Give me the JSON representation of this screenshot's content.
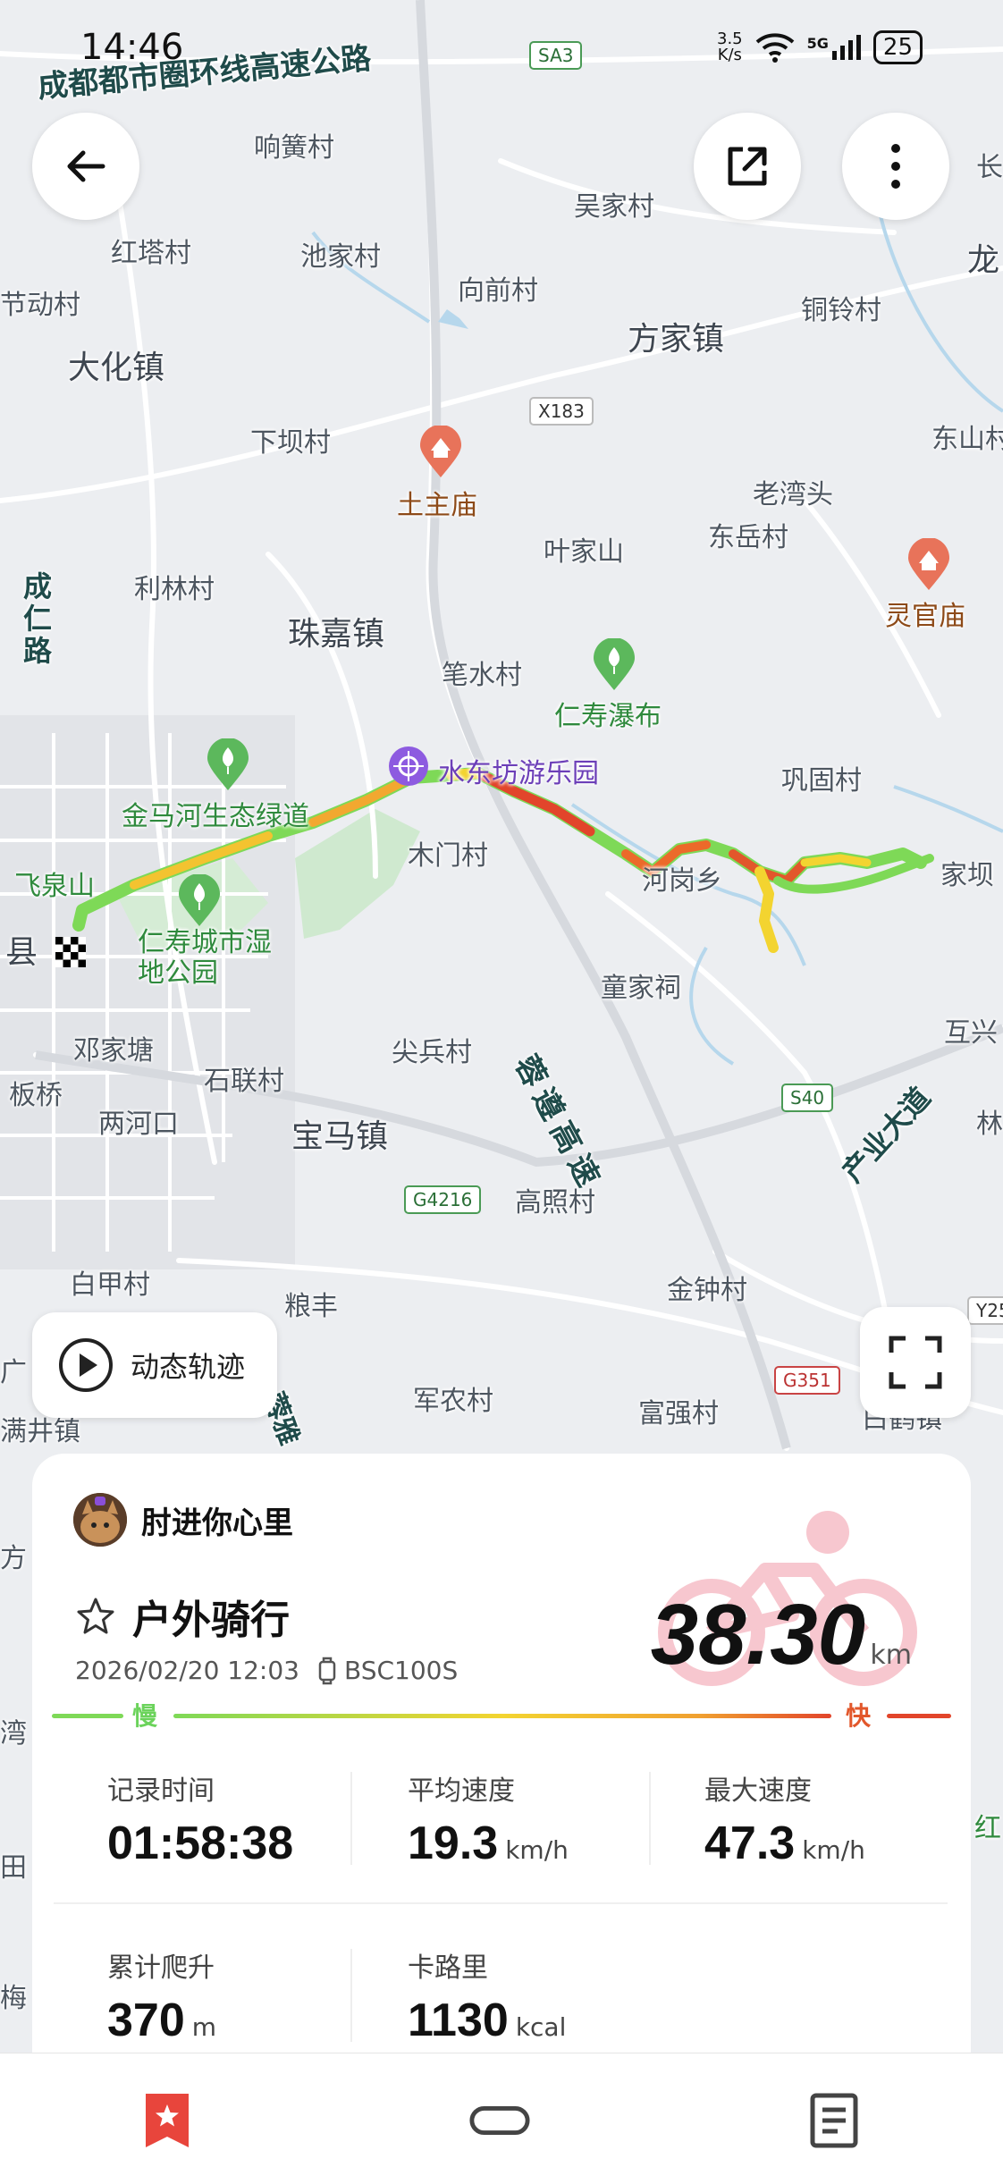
{
  "status_bar": {
    "time": "14:46",
    "net_speed_value": "3.5",
    "net_speed_unit": "K/s",
    "network_type": "5G",
    "battery": "25"
  },
  "map": {
    "roads": {
      "ring_expressway": "成都都市圈环线高速公路",
      "rong_zun": "蓉遵高速",
      "industry_ave": "产业大道",
      "left_road": "成仁路",
      "bottom_road": "蓉雅"
    },
    "shields": [
      "SA3",
      "X183",
      "S40",
      "G4216",
      "G351",
      "Y25"
    ],
    "towns": [
      "大化镇",
      "方家镇",
      "珠嘉镇",
      "宝马镇"
    ],
    "villages": [
      "响簧村",
      "吴家村",
      "红塔村",
      "池家村",
      "向前村",
      "铜铃村",
      "节动村",
      "下坝村",
      "东山村",
      "老湾头",
      "东岳村",
      "叶家山",
      "利林村",
      "笔水村",
      "巩固村",
      "木门村",
      "童家祠",
      "邓家塘",
      "石联村",
      "尖兵村",
      "两河口",
      "高照村",
      "白甲村",
      "金钟村",
      "粮丰",
      "军农村",
      "富强村",
      "满井镇",
      "互兴",
      "家坝",
      "板桥",
      "县",
      "龙",
      "长",
      "林",
      "方",
      "湾",
      "田",
      "红",
      "白鹤镇",
      "梅",
      "广"
    ],
    "pois": {
      "tuzhu_temple": "土主庙",
      "lingguan_temple": "灵官庙",
      "renshou_waterfall": "仁寿瀑布",
      "jinmahe_park": "金马河生态绿道",
      "renshou_wetland": "仁寿城市湿地公园",
      "feiquan_mountain": "飞泉山",
      "fun_park": "水东坊游乐园",
      "hegang_town": "河岗乡"
    }
  },
  "replay_button": {
    "label": "动态轨迹"
  },
  "summary": {
    "username": "肘进你心里",
    "activity_type": "户外骑行",
    "datetime": "2026/02/20 12:03",
    "device": "BSC100S",
    "distance": "38.30",
    "distance_unit": "km",
    "legend_slow": "慢",
    "legend_fast": "快",
    "stats": [
      {
        "label": "记录时间",
        "value": "01:58:38",
        "unit": ""
      },
      {
        "label": "平均速度",
        "value": "19.3",
        "unit": "km/h"
      },
      {
        "label": "最大速度",
        "value": "47.3",
        "unit": "km/h"
      },
      {
        "label": "累计爬升",
        "value": "370",
        "unit": "m"
      },
      {
        "label": "卡路里",
        "value": "1130",
        "unit": "kcal"
      }
    ]
  },
  "colors": {
    "track_slow": "#7ed957",
    "track_mid": "#f3d430",
    "track_fast": "#e2452b",
    "accent_red": "#e8453c",
    "park_green": "#cfe9cf"
  },
  "icons": [
    "back-arrow-icon",
    "share-icon",
    "more-vertical-icon",
    "play-icon",
    "fullscreen-icon",
    "star-outline-icon",
    "watch-icon",
    "bicycle-icon",
    "favorites-tab-icon",
    "device-tab-icon",
    "report-tab-icon",
    "finish-flag-icon"
  ]
}
